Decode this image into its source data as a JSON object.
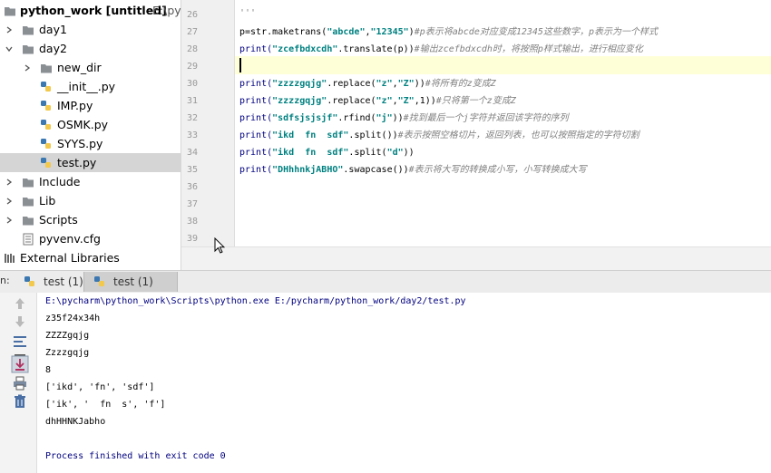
{
  "sidebar": {
    "project_name": "python_work [untitled]",
    "project_path": "E:\\pyc",
    "items": [
      {
        "label": "day1",
        "type": "folder",
        "expanded": false
      },
      {
        "label": "day2",
        "type": "folder",
        "expanded": true
      },
      {
        "label": "new_dir",
        "type": "folder",
        "expanded": false
      },
      {
        "label": "__init__.py",
        "type": "python"
      },
      {
        "label": "IMP.py",
        "type": "python"
      },
      {
        "label": "OSMK.py",
        "type": "python"
      },
      {
        "label": "SYYS.py",
        "type": "python"
      },
      {
        "label": "test.py",
        "type": "python",
        "selected": true
      },
      {
        "label": "Include",
        "type": "folder",
        "expanded": false
      },
      {
        "label": "Lib",
        "type": "folder",
        "expanded": false
      },
      {
        "label": "Scripts",
        "type": "folder",
        "expanded": false
      },
      {
        "label": "pyvenv.cfg",
        "type": "config"
      },
      {
        "label": "External Libraries",
        "type": "libraries"
      }
    ]
  },
  "editor": {
    "line_numbers": [
      "26",
      "27",
      "28",
      "29",
      "30",
      "31",
      "32",
      "33",
      "34",
      "35",
      "36",
      "37",
      "38",
      "39"
    ],
    "lines": {
      "l26": "'''",
      "l27a": "p=str.maketrans(",
      "l27b": "\"abcde\"",
      "l27c": ",",
      "l27d": "\"12345\"",
      "l27e": ")",
      "l27f": "#p表示将abcde对应变成12345这些数字，p表示为一个样式",
      "l28a": "print(",
      "l28b": "\"zcefbdxcdh\"",
      "l28c": ".translate(p))",
      "l28d": "#输出zcefbdxcdh时，将按照p样式输出，进行相应变化",
      "l30a": "print(",
      "l30b": "\"zzzzgqjg\"",
      "l30c": ".replace(",
      "l30d": "\"z\"",
      "l30e": ",",
      "l30f": "\"Z\"",
      "l30g": "))",
      "l30h": "#将所有的z变成Z",
      "l31a": "print(",
      "l31b": "\"zzzzgqjg\"",
      "l31c": ".replace(",
      "l31d": "\"z\"",
      "l31e": ",",
      "l31f": "\"Z\"",
      "l31g": ",1))",
      "l31h": "#只将第一个z变成Z",
      "l32a": "print(",
      "l32b": "\"sdfsjsjsjf\"",
      "l32c": ".rfind(",
      "l32d": "\"j\"",
      "l32e": "))",
      "l32f": "#找到最后一个j字符并返回该字符的序列",
      "l33a": "print(",
      "l33b": "\"ikd  fn  sdf\"",
      "l33c": ".split())",
      "l33d": "#表示按照空格切片，返回列表，也可以按照指定的字符切割",
      "l34a": "print(",
      "l34b": "\"ikd  fn  sdf\"",
      "l34c": ".split(",
      "l34d": "\"d\"",
      "l34e": "))",
      "l35a": "print(",
      "l35b": "\"DHhhnkjABHO\"",
      "l35c": ".swapcase())",
      "l35d": "#表示将大写的转换成小写，小写转换成大写"
    }
  },
  "run_panel": {
    "label": "n:",
    "tabs": [
      {
        "label": "test (1)",
        "active": false
      },
      {
        "label": "test (1)",
        "active": true
      }
    ]
  },
  "console": {
    "lines": [
      {
        "text": "E:\\pycharm\\python_work\\Scripts\\python.exe E:/pycharm/python_work/day2/test.py",
        "kind": "path"
      },
      {
        "text": "z35f24x34h",
        "kind": "out"
      },
      {
        "text": "ZZZZgqjg",
        "kind": "out"
      },
      {
        "text": "Zzzzgqjg",
        "kind": "out"
      },
      {
        "text": "8",
        "kind": "out"
      },
      {
        "text": "['ikd', 'fn', 'sdf']",
        "kind": "out"
      },
      {
        "text": "['ik', '  fn  s', 'f']",
        "kind": "out"
      },
      {
        "text": "dhHHNKJabho",
        "kind": "out"
      },
      {
        "text": "",
        "kind": "out"
      },
      {
        "text": "Process finished with exit code 0",
        "kind": "exit"
      }
    ]
  },
  "colors": {
    "keyword": "#000080",
    "string": "#008080",
    "comment": "#808080",
    "current_line": "#ffffd7",
    "selected_item": "#d5d5d5"
  },
  "icons": {
    "folder": "folder-icon",
    "python": "python-file-icon",
    "config": "config-file-icon",
    "libraries": "libraries-icon"
  }
}
